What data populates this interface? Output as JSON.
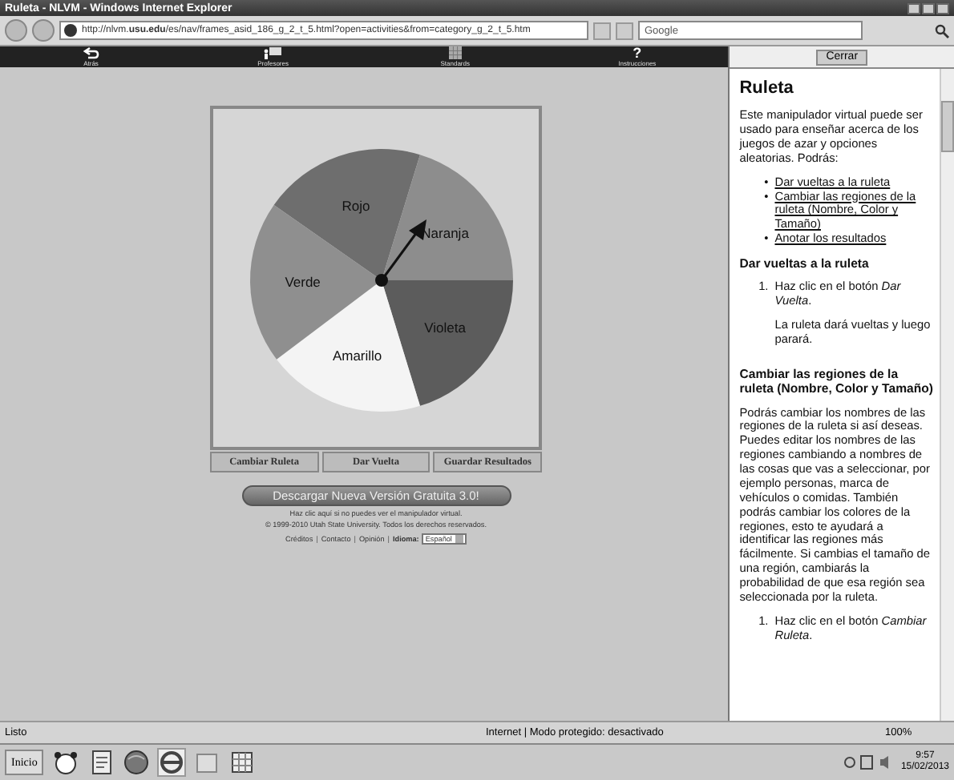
{
  "window": {
    "title": "Ruleta - NLVM - Windows Internet Explorer"
  },
  "address_bar": {
    "url": "http://nlvm.**usu.edu**/es/nav/frames_asid_186_g_2_t_5.html?open=activities&from=category_g_2_t_5.htm"
  },
  "search": {
    "placeholder": "Google"
  },
  "nav_toolbar": [
    {
      "label": "Atrás",
      "kind": "back"
    },
    {
      "label": "Profesores",
      "kind": "teachers"
    },
    {
      "label": "Standards",
      "kind": "standards"
    },
    {
      "label": "Instrucciones",
      "kind": "help",
      "glyph": "?"
    }
  ],
  "spinner": {
    "regions": [
      {
        "name": "Rojo",
        "color": "#6e6e6e"
      },
      {
        "name": "Naranja",
        "color": "#8d8d8d"
      },
      {
        "name": "Violeta",
        "color": "#5c5c5c"
      },
      {
        "name": "Amarillo",
        "color": "#f4f4f4"
      },
      {
        "name": "Verde",
        "color": "#8f8f8f"
      }
    ],
    "buttons": [
      "Cambiar Ruleta",
      "Dar Vuelta",
      "Guardar Resultados"
    ]
  },
  "download_button": "Descargar Nueva Versión Gratuita 3.0!",
  "footer": {
    "lines": [
      "Haz clic aquí si no puedes ver el manipulador virtual.",
      "© 1999-2010 Utah State University. Todos los derechos reservados."
    ],
    "links": [
      "Créditos",
      "Contacto",
      "Opinión"
    ],
    "separator": "|",
    "language_label": "Idioma:",
    "language_value": "Español"
  },
  "help_panel": {
    "close_button": "Cerrar",
    "title": "Ruleta",
    "intro": "Este manipulador virtual puede ser usado para enseñar acerca de los juegos de azar y opciones aleatorias. Podrás:",
    "bullet": "•",
    "links": [
      "Dar vueltas a la ruleta",
      "Cambiar las regiones de la ruleta (Nombre, Color y Tamaño)",
      "Anotar los resultados"
    ],
    "sections": [
      {
        "heading": "Dar vueltas a la ruleta",
        "steps": [
          {
            "number": "1.",
            "text": "Haz clic en el botón *Dar Vuelta*.",
            "note": "La ruleta dará vueltas y luego parará."
          }
        ]
      },
      {
        "heading": "Cambiar las regiones de la ruleta (Nombre, Color y Tamaño)",
        "body": "Podrás cambiar los nombres de las regiones de la ruleta si así deseas. Puedes editar los nombres de las regiones cambiando a nombres de las cosas que vas a seleccionar, por ejemplo personas, marca de vehículos o comidas. También podrás cambiar los colores de la regiones, esto te ayudará a identificar las regiones más fácilmente. Si cambias el tamaño de una región, cambiarás la probabilidad de que esa región sea seleccionada por la ruleta.",
        "steps": [
          {
            "number": "1.",
            "text": "Haz clic en el botón *Cambiar Ruleta*."
          }
        ]
      }
    ]
  },
  "status_bar": {
    "text": "Listo",
    "zone": "Internet | Modo protegido: desactivado",
    "zoom": "100%"
  },
  "taskbar": {
    "start": "Inicio",
    "time": "9:57",
    "date": "15/02/2013"
  }
}
